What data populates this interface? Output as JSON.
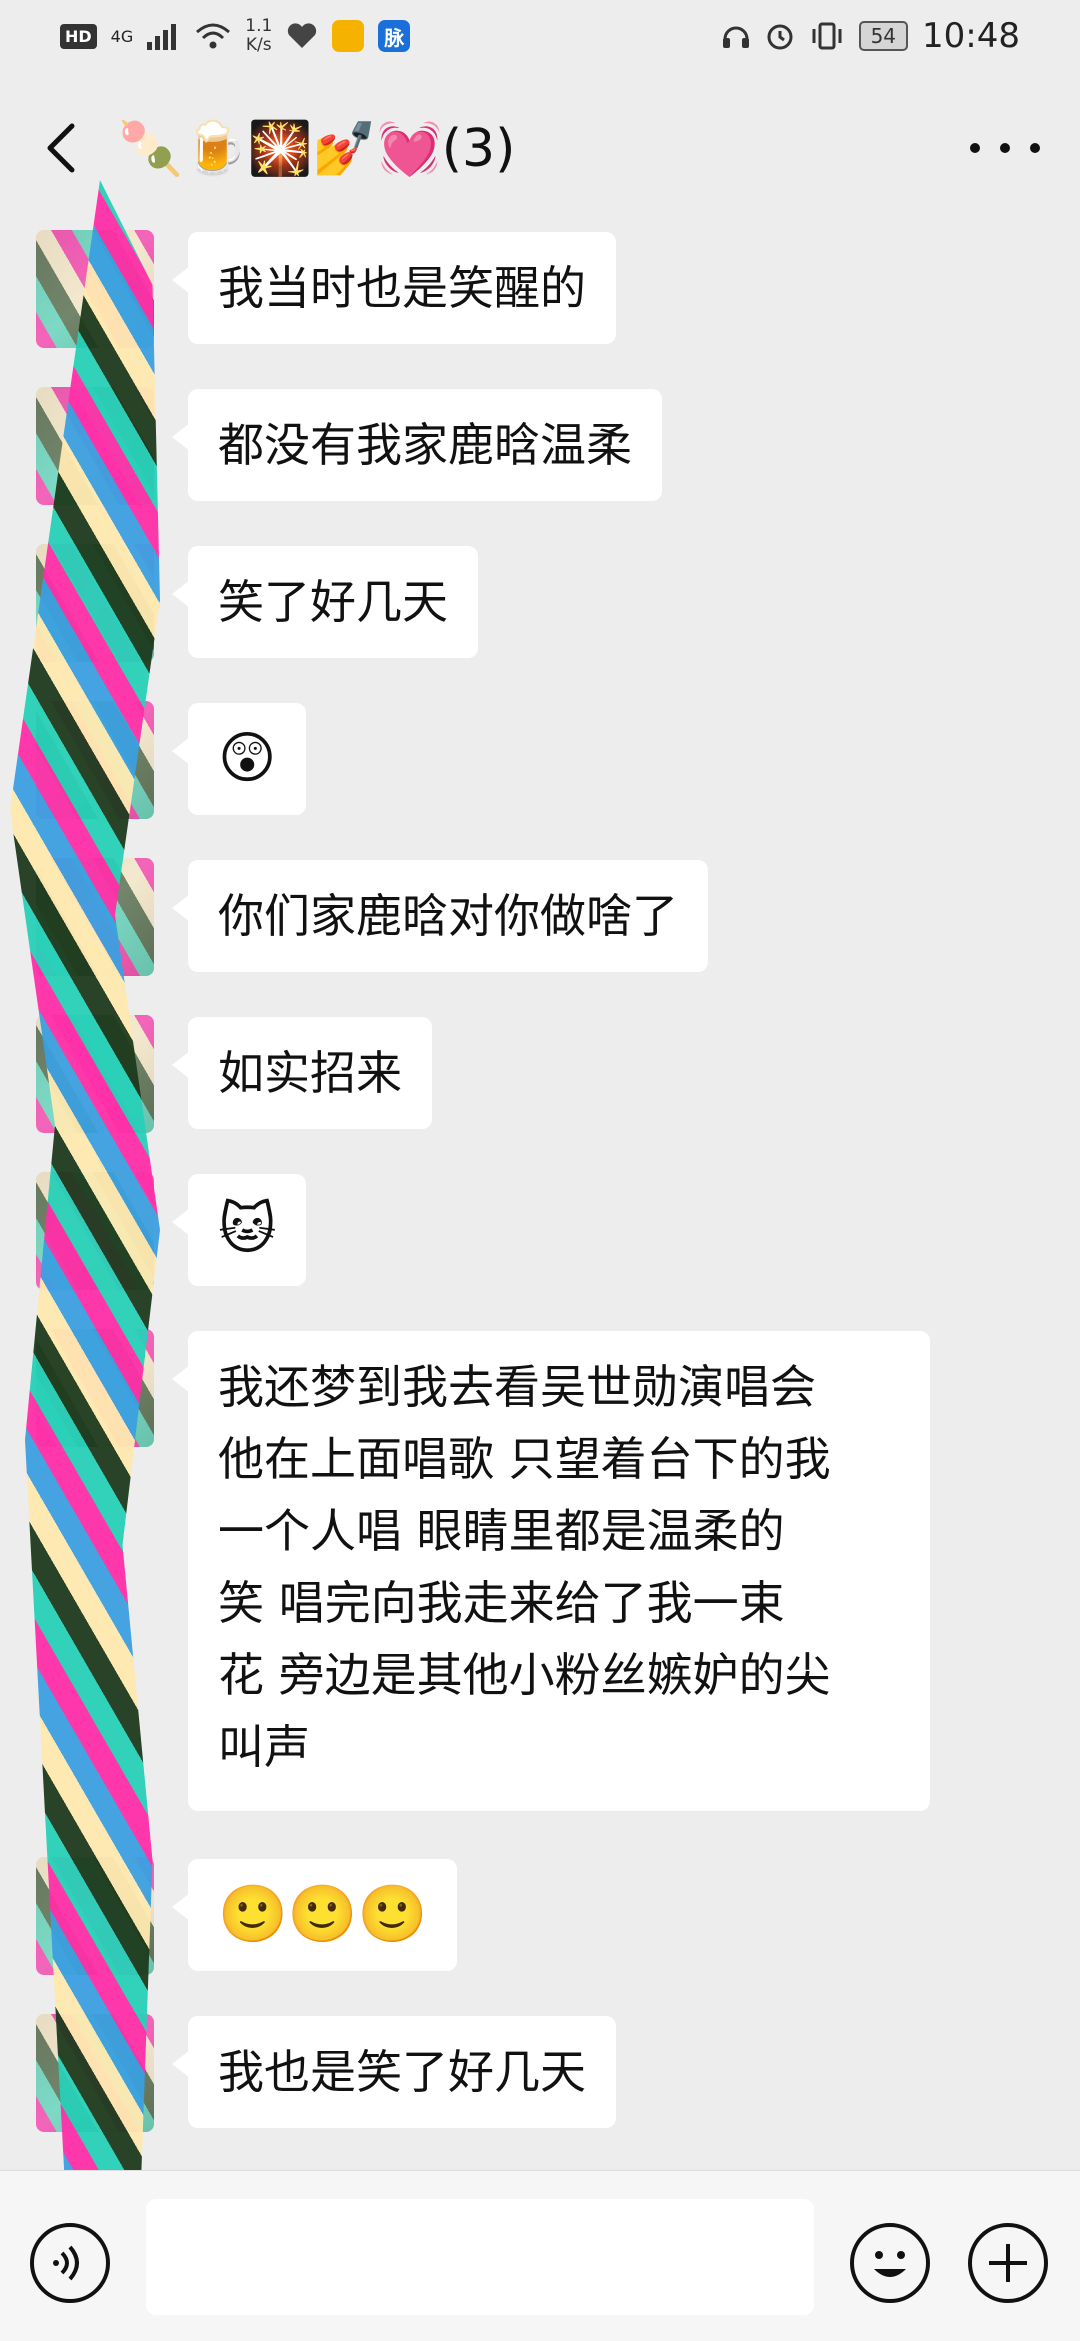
{
  "status_bar": {
    "hd": "HD",
    "network": "4G",
    "speed_value": "1.1",
    "speed_unit": "K/s",
    "pulse_app": "脉",
    "battery": "54",
    "time": "10:48"
  },
  "header": {
    "title": "🍡🍺🎇💅💓(3)"
  },
  "messages": [
    {
      "text": "我当时也是笑醒的"
    },
    {
      "text": "都没有我家鹿晗温柔"
    },
    {
      "text": "笑了好几天"
    },
    {
      "text": "😲"
    },
    {
      "text": "你们家鹿晗对你做啥了"
    },
    {
      "text": "如实招来"
    },
    {
      "text": "🐱"
    },
    {
      "text": "我还梦到我去看吴世勋演唱会\n他在上面唱歌  只望着台下的我\n一个人唱  眼睛里都是温柔的\n笑  唱完向我走来给了我一束\n花  旁边是其他小粉丝嫉妒的尖\n叫声"
    },
    {
      "text": "🙂🙂🙂"
    },
    {
      "text": "我也是笑了好几天"
    }
  ],
  "colors": {
    "background": "#ededed",
    "bubble": "#ffffff",
    "input_bar": "#f6f6f6"
  }
}
